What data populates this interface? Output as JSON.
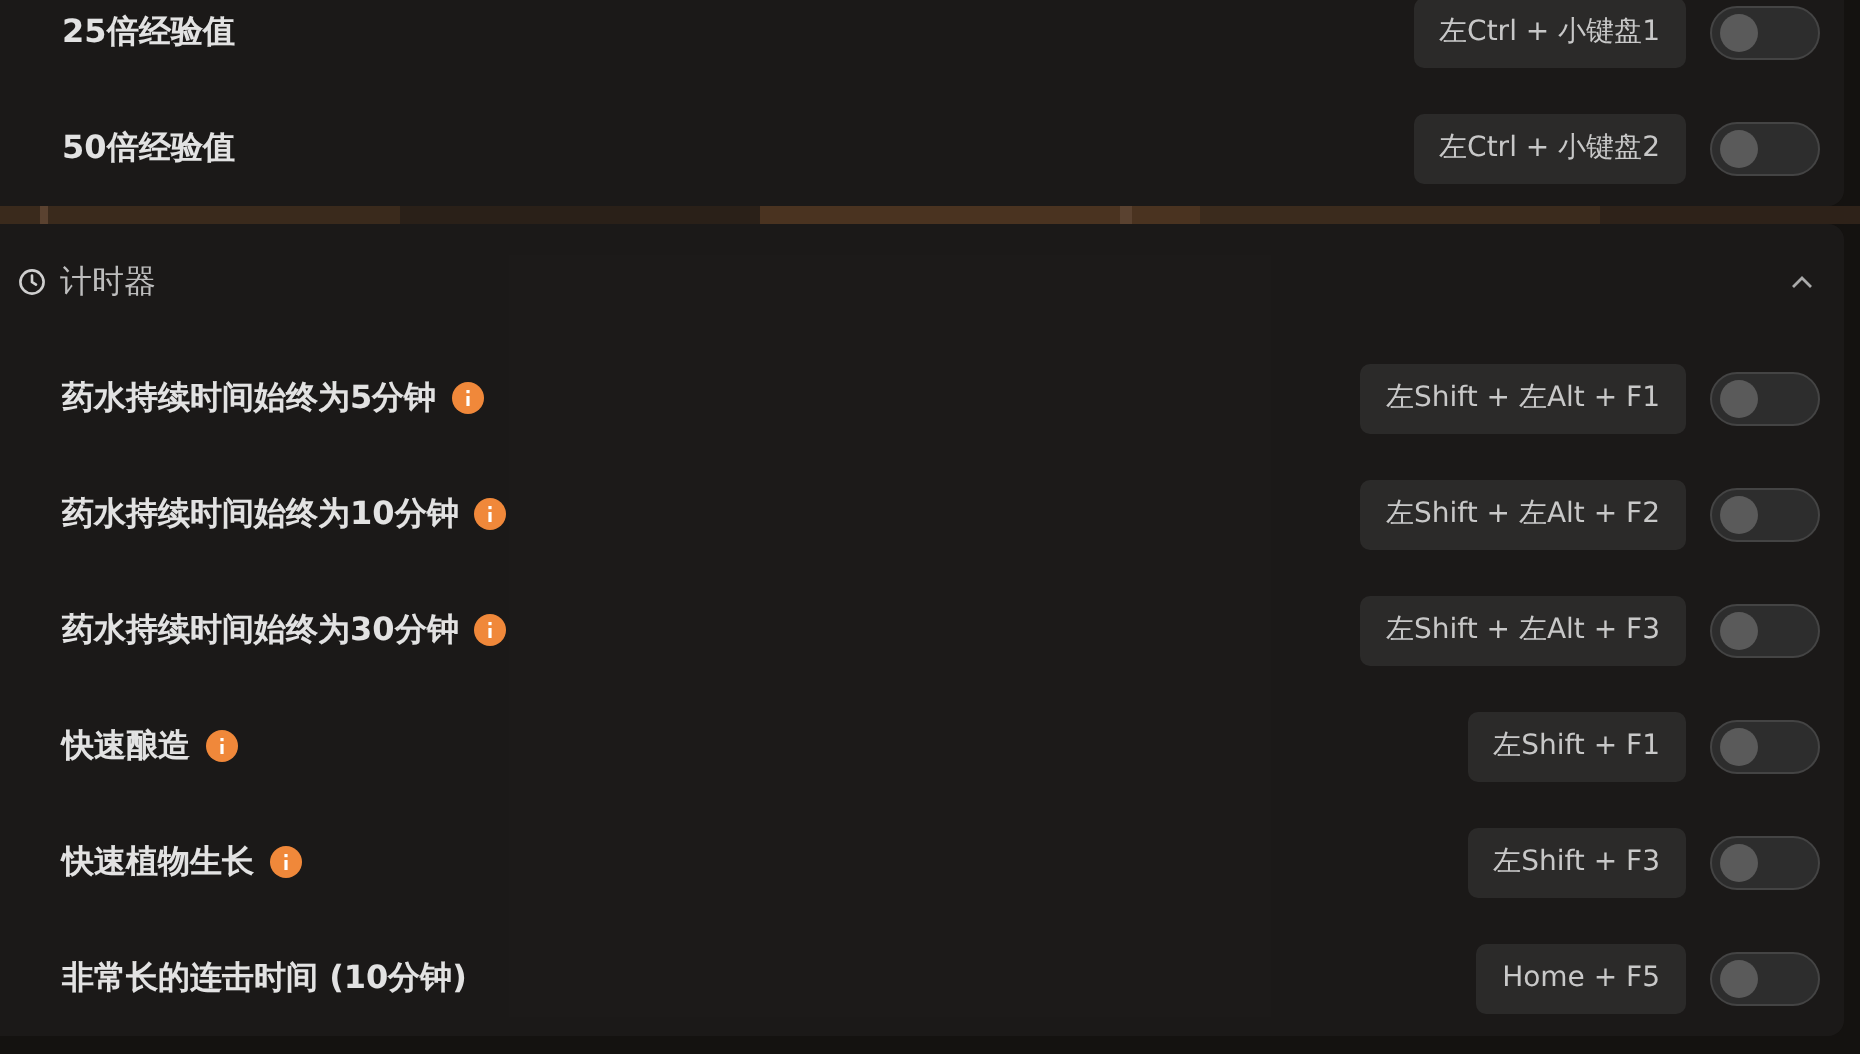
{
  "sections": [
    {
      "rows": [
        {
          "label": "25倍经验值",
          "info": false,
          "hotkey": "左Ctrl + 小键盘1",
          "on": false
        },
        {
          "label": "50倍经验值",
          "info": false,
          "hotkey": "左Ctrl + 小键盘2",
          "on": false
        }
      ]
    },
    {
      "title": "计时器",
      "expanded": true,
      "rows": [
        {
          "label": "药水持续时间始终为5分钟",
          "info": true,
          "hotkey": "左Shift + 左Alt + F1",
          "on": false
        },
        {
          "label": "药水持续时间始终为10分钟",
          "info": true,
          "hotkey": "左Shift + 左Alt + F2",
          "on": false
        },
        {
          "label": "药水持续时间始终为30分钟",
          "info": true,
          "hotkey": "左Shift + 左Alt + F3",
          "on": false
        },
        {
          "label": "快速酿造",
          "info": true,
          "hotkey": "左Shift + F1",
          "on": false
        },
        {
          "label": "快速植物生长",
          "info": true,
          "hotkey": "左Shift + F3",
          "on": false
        },
        {
          "label": "非常长的连击时间 (10分钟)",
          "info": false,
          "hotkey": "Home + F5",
          "on": false
        }
      ]
    }
  ]
}
